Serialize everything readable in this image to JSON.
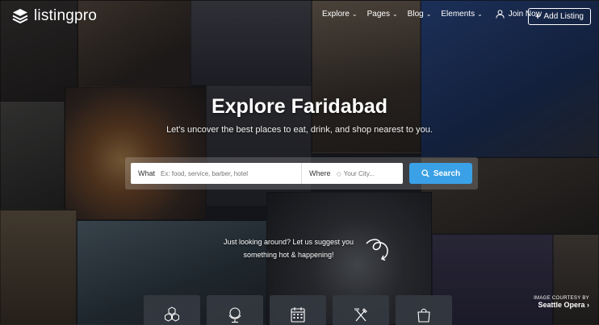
{
  "header": {
    "logo_text": "listingpro",
    "nav": [
      {
        "label": "Explore",
        "icon": "chevron-down-icon"
      },
      {
        "label": "Pages",
        "icon": "chevron-down-icon"
      },
      {
        "label": "Blog",
        "icon": "chevron-down-icon"
      },
      {
        "label": "Elements",
        "icon": "chevron-down-icon"
      }
    ],
    "join_label": "Join Now",
    "add_listing_label": "Add Listing"
  },
  "hero": {
    "title": "Explore Faridabad",
    "subtitle": "Let's uncover the best places to eat, drink, and shop nearest to you."
  },
  "search": {
    "what_label": "What",
    "what_placeholder": "Ex: food, service, barber, hotel",
    "where_label": "Where",
    "where_placeholder": "Your City...",
    "button_label": "Search",
    "button_color": "#3aa1e6"
  },
  "suggestion": {
    "text": "Just looking around? Let us suggest you something hot & happening!"
  },
  "credit": {
    "label": "IMAGE COURTESY BY",
    "name": "Seattle Opera ›"
  },
  "categories": [
    {
      "icon": "hexagon-cluster-icon"
    },
    {
      "icon": "globe-stand-icon"
    },
    {
      "icon": "calendar-icon"
    },
    {
      "icon": "fork-knife-icon"
    },
    {
      "icon": "shopping-bag-icon"
    }
  ]
}
